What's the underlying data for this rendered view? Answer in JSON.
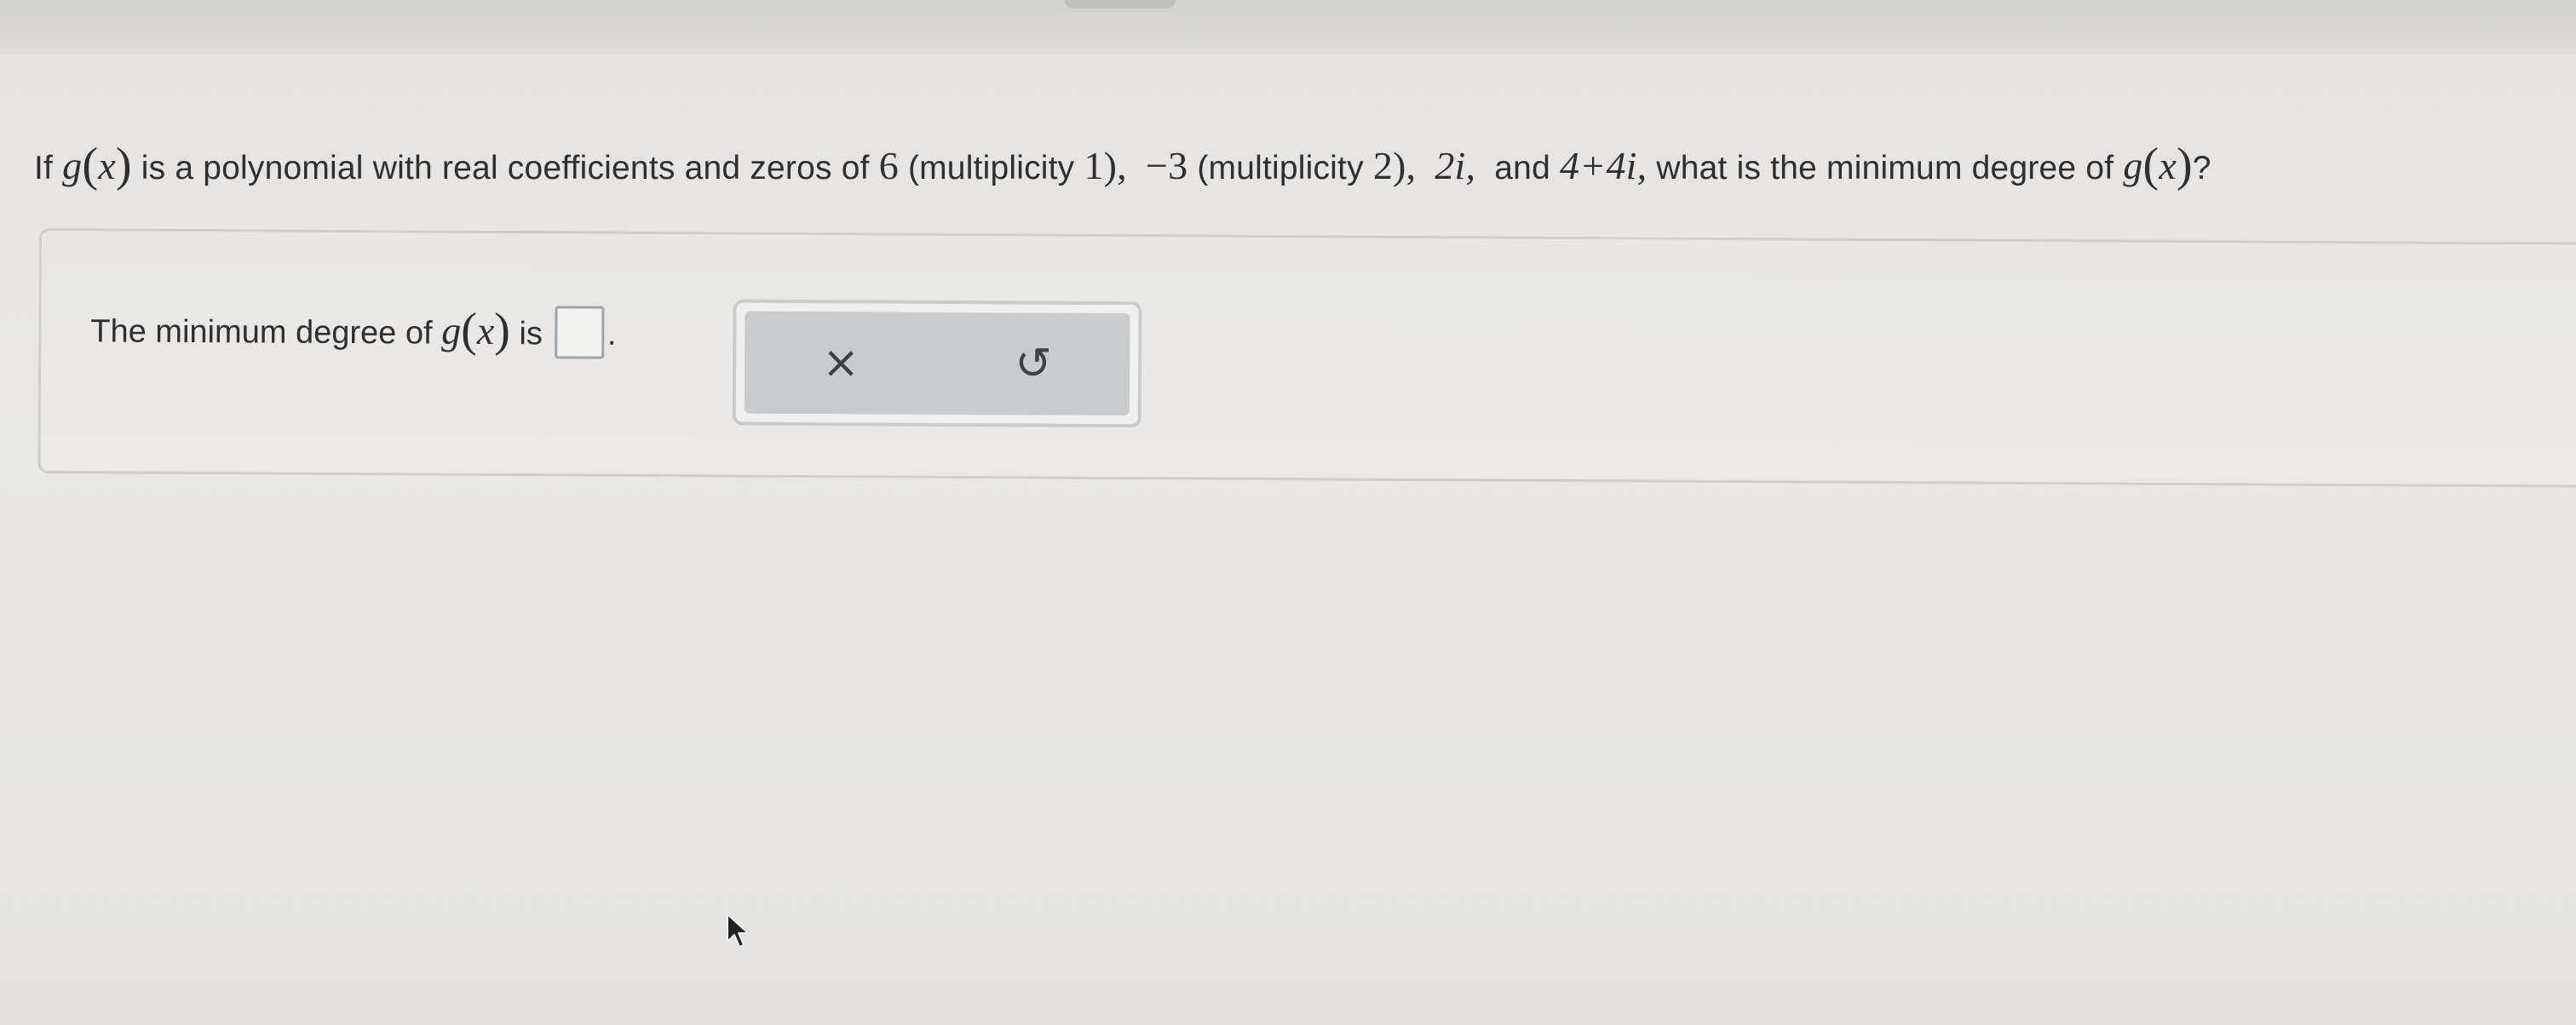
{
  "question": {
    "if": "If",
    "fn1": "g",
    "arg1": "x",
    "text1": "is a polynomial with real coefficients and zeros of",
    "zero1": "6",
    "mult1": "(multiplicity",
    "mult1_val": "1),",
    "zero2": "−3",
    "mult2": "(multiplicity",
    "mult2_val": "2),",
    "zero3": "2i,",
    "and": "and",
    "zero4": "4+4i,",
    "text2": "what is the minimum degree of",
    "fn2": "g",
    "arg2": "x",
    "qmark": "?"
  },
  "answer": {
    "prefix": "The minimum degree of",
    "fn": "g",
    "arg": "x",
    "is": "is",
    "value": "",
    "period": "."
  },
  "tools": {
    "clear_icon": "×",
    "reset_icon": "↺"
  },
  "icons": {
    "clear": "close-icon",
    "reset": "undo-icon",
    "pointer": "mouse-cursor-icon"
  }
}
